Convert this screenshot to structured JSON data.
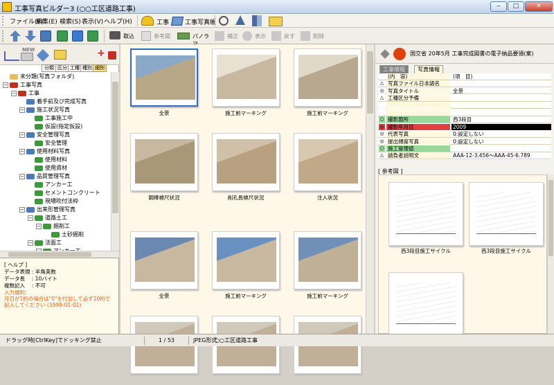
{
  "window": {
    "title": "工事写真ビルダー3 (○○工区道路工事)",
    "minimize": "‒",
    "maximize": "□",
    "close": "✕"
  },
  "menu": [
    "ファイル(F)",
    "編集(E)",
    "検索(S)",
    "表示(V)",
    "ヘルプ(H)"
  ],
  "toolbar_top": {
    "koji": "工事",
    "shashincho": "工事写真帳"
  },
  "toolbar": {
    "torikomi": "取込",
    "sankozu": "参考図",
    "panorama": "パノラマ",
    "hosei": "補正",
    "hyoji": "表示",
    "modosu": "戻す",
    "sakujo": "削除"
  },
  "tree_tabs": [
    "分類",
    "区分",
    "工種",
    "種別",
    "細別"
  ],
  "tree_new": "NEW",
  "tree": [
    {
      "label": "未分類(写真フォルダ)",
      "level": 0,
      "pm": "",
      "color": "#e0c060"
    },
    {
      "label": "工事写真",
      "level": 0,
      "pm": "−",
      "color": "#c03020"
    },
    {
      "label": "工事",
      "level": 1,
      "pm": "−",
      "color": "#c03020"
    },
    {
      "label": "着手前及び完成写真",
      "level": 2,
      "pm": "",
      "color": "#4a7ab8"
    },
    {
      "label": "施工状況写真",
      "level": 2,
      "pm": "−",
      "color": "#4a7ab8"
    },
    {
      "label": "工事施工中",
      "level": 3,
      "pm": "",
      "color": "#3a9a3a"
    },
    {
      "label": "仮設(指定仮設)",
      "level": 3,
      "pm": "",
      "color": "#3a9a3a"
    },
    {
      "label": "安全管理写真",
      "level": 2,
      "pm": "−",
      "color": "#4a7ab8"
    },
    {
      "label": "安全管理",
      "level": 3,
      "pm": "",
      "color": "#3a9a3a"
    },
    {
      "label": "使用材料写真",
      "level": 2,
      "pm": "−",
      "color": "#4a7ab8"
    },
    {
      "label": "使用材料",
      "level": 3,
      "pm": "",
      "color": "#3a9a3a"
    },
    {
      "label": "使用資材",
      "level": 3,
      "pm": "",
      "color": "#3a9a3a"
    },
    {
      "label": "品質管理写真",
      "level": 2,
      "pm": "−",
      "color": "#4a7ab8"
    },
    {
      "label": "アンカー工",
      "level": 3,
      "pm": "",
      "color": "#3a9a3a"
    },
    {
      "label": "セメントコンクリート",
      "level": 3,
      "pm": "",
      "color": "#3a9a3a"
    },
    {
      "label": "現場吹付法枠",
      "level": 3,
      "pm": "",
      "color": "#3a9a3a"
    },
    {
      "label": "出来形管理写真",
      "level": 2,
      "pm": "−",
      "color": "#4a7ab8"
    },
    {
      "label": "道路土工",
      "level": 3,
      "pm": "−",
      "color": "#3a9a3a"
    },
    {
      "label": "掘削工",
      "level": 4,
      "pm": "−",
      "color": "#3a9a3a"
    },
    {
      "label": "土砂掘削",
      "level": 5,
      "pm": "",
      "color": "#3a9a3a"
    },
    {
      "label": "法面工",
      "level": 3,
      "pm": "−",
      "color": "#3a9a3a"
    },
    {
      "label": "アンカー工",
      "level": 4,
      "pm": "−",
      "color": "#3a9a3a"
    }
  ],
  "help": {
    "header": "[ ヘルプ ]",
    "lines": [
      "データ表現 : 半角英数",
      "データ長 　: 10バイト",
      "複数記入 　: 不可"
    ],
    "notes": [
      "入力規則:",
      "月日が1桁の場合は\"0\"を付加して必ず10桁で",
      "記入してください (1999-01-01)"
    ]
  },
  "gallery": [
    {
      "caption": "全景",
      "selected": true,
      "sky": "#8aa8c8",
      "ground": "#b8a888"
    },
    {
      "caption": "施工前マーキング",
      "selected": false,
      "sky": "#e8e0d0",
      "ground": "#c8b8a0"
    },
    {
      "caption": "施工前マーキング",
      "selected": false,
      "sky": "#e0d8c8",
      "ground": "#b8a890"
    },
    {
      "caption": "鋼棒検尺状況",
      "selected": false,
      "sky": "#c8b8a0",
      "ground": "#a89878"
    },
    {
      "caption": "削孔長検尺状況",
      "selected": false,
      "sky": "#d0c0a8",
      "ground": "#b8a080"
    },
    {
      "caption": "注入状況",
      "selected": false,
      "sky": "#d8c8b0",
      "ground": "#c0a888"
    },
    {
      "caption": "全景",
      "selected": false,
      "sky": "#6a88b0",
      "ground": "#c8b8a0"
    },
    {
      "caption": "施工前マーキング",
      "selected": false,
      "sky": "#6890c0",
      "ground": "#c8b8a0"
    },
    {
      "caption": "施工前マーキング",
      "selected": false,
      "sky": "#7090b8",
      "ground": "#c0b098"
    },
    {
      "caption": "",
      "selected": false,
      "sky": "#d0c8b8",
      "ground": "#c0b098"
    },
    {
      "caption": "",
      "selected": false,
      "sky": "#d0c8b8",
      "ground": "#c0b098"
    },
    {
      "caption": "",
      "selected": false,
      "sky": "#d0c8b8",
      "ground": "#c0b098"
    }
  ],
  "right": {
    "title": "国交省 20年5月 工事完成図書の電子納品要領(案)",
    "tab1": "工事情報",
    "tab2": "写真情報",
    "props": [
      {
        "mark": "",
        "key": "(内　容)",
        "val": "(項　目)",
        "mcolor": "#fff",
        "kcolor": "#fff8e0"
      },
      {
        "mark": "△",
        "key": "写真ファイル日本語名",
        "val": "",
        "mcolor": "#fff",
        "kcolor": "#fff8e0"
      },
      {
        "mark": "◎",
        "key": "写真タイトル",
        "val": "全景",
        "mcolor": "#fff",
        "kcolor": "#fff8e0"
      },
      {
        "mark": "△",
        "key": "工種区分予備",
        "val": "",
        "mcolor": "#fff",
        "kcolor": "#fff8e0"
      },
      {
        "mark": "",
        "key": "",
        "val": "",
        "mcolor": "#fff",
        "kcolor": "#fff8e0"
      },
      {
        "mark": "",
        "key": "",
        "val": "",
        "mcolor": "#fff",
        "kcolor": "#fff8e0"
      },
      {
        "mark": "○",
        "key": "撮影箇所",
        "val": "西3段目",
        "mcolor": "#9ad89a",
        "kcolor": "#9ad89a"
      },
      {
        "mark": "◎",
        "key": "撮影年月日",
        "val": "2009",
        "mcolor": "#e04040",
        "kcolor": "#e04040"
      },
      {
        "mark": "◎",
        "key": "代表写真",
        "val": "0:設定しない",
        "mcolor": "#fff",
        "kcolor": "#fff8e0"
      },
      {
        "mark": "◎",
        "key": "提出頻度写真",
        "val": "0:設定しない",
        "mcolor": "#fff",
        "kcolor": "#fff8e0"
      },
      {
        "mark": "○",
        "key": "施工管理値",
        "val": "",
        "mcolor": "#9ad89a",
        "kcolor": "#9ad89a"
      },
      {
        "mark": "△",
        "key": "請負者説明文",
        "val": "AAA-12-3.456～AAA-45-6.789",
        "mcolor": "#fff",
        "kcolor": "#fff8e0"
      }
    ],
    "ref_label": "[ 参考図 ]",
    "refs": [
      {
        "caption": "西3段目施工サイクル"
      },
      {
        "caption": "西3段目施工サイクル"
      },
      {
        "caption": ""
      }
    ]
  },
  "status": {
    "hint": "ドラッグ時[CtrlKey]でドッキング禁止",
    "page": "1 / 53",
    "format": "JPEG形式",
    "project": "○○工区道路工事"
  }
}
